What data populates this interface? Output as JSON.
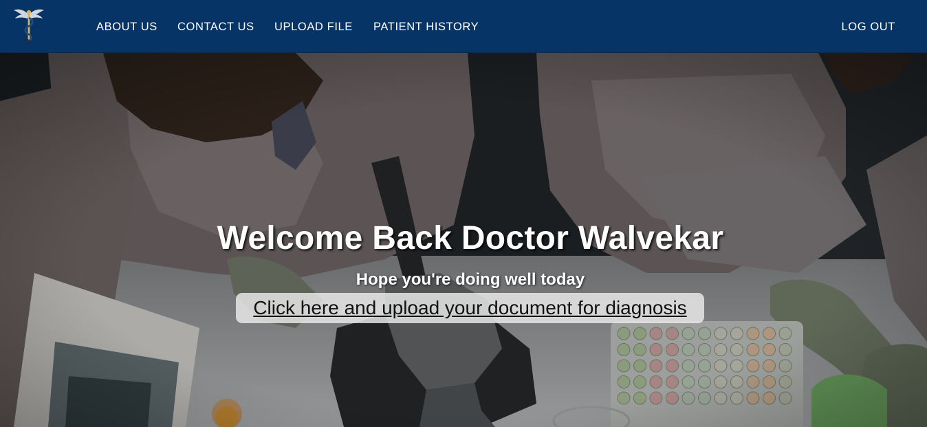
{
  "nav": {
    "logo_icon": "caduceus-wings-icon",
    "links": [
      "ABOUT US",
      "CONTACT US",
      "UPLOAD FILE",
      "PATIENT HISTORY"
    ],
    "logout_label": "LOG OUT",
    "bar_color": "#063466"
  },
  "hero": {
    "background": "lab-scientists-microscope-photo",
    "title": "Welcome Back Doctor Walvekar",
    "subtitle": "Hope you're doing well today",
    "cta_label": "Click here and upload your document for diagnosis"
  }
}
